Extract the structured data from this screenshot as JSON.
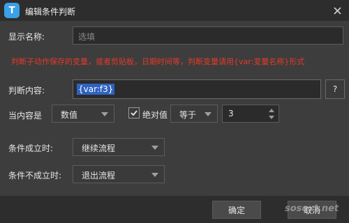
{
  "window": {
    "title": "编辑条件判断",
    "logo_letter": "T"
  },
  "form": {
    "display_name_label": "显示名称:",
    "display_name_placeholder": "选填",
    "warning": "判断子动作保存的变量，或者剪贴板，日期时间等，判断变量请用{var:变量名称}形式",
    "content_label": "判断内容:",
    "content_value": "{var:f3}",
    "help_label": "?",
    "when_content_label": "当内容是",
    "type_value": "数值",
    "abs_label": "绝对值",
    "abs_checked": true,
    "compare_value": "等于",
    "number_value": "3",
    "true_label": "条件成立时:",
    "true_value": "继续流程",
    "false_label": "条件不成立时:",
    "false_value": "退出流程"
  },
  "footer": {
    "ok_label": "确定",
    "cancel_label": "取消"
  },
  "watermark": "sosoxt.net",
  "colors": {
    "accent": "#3aa0e8",
    "warning": "#e23a2a",
    "selection": "#2f62c0"
  }
}
